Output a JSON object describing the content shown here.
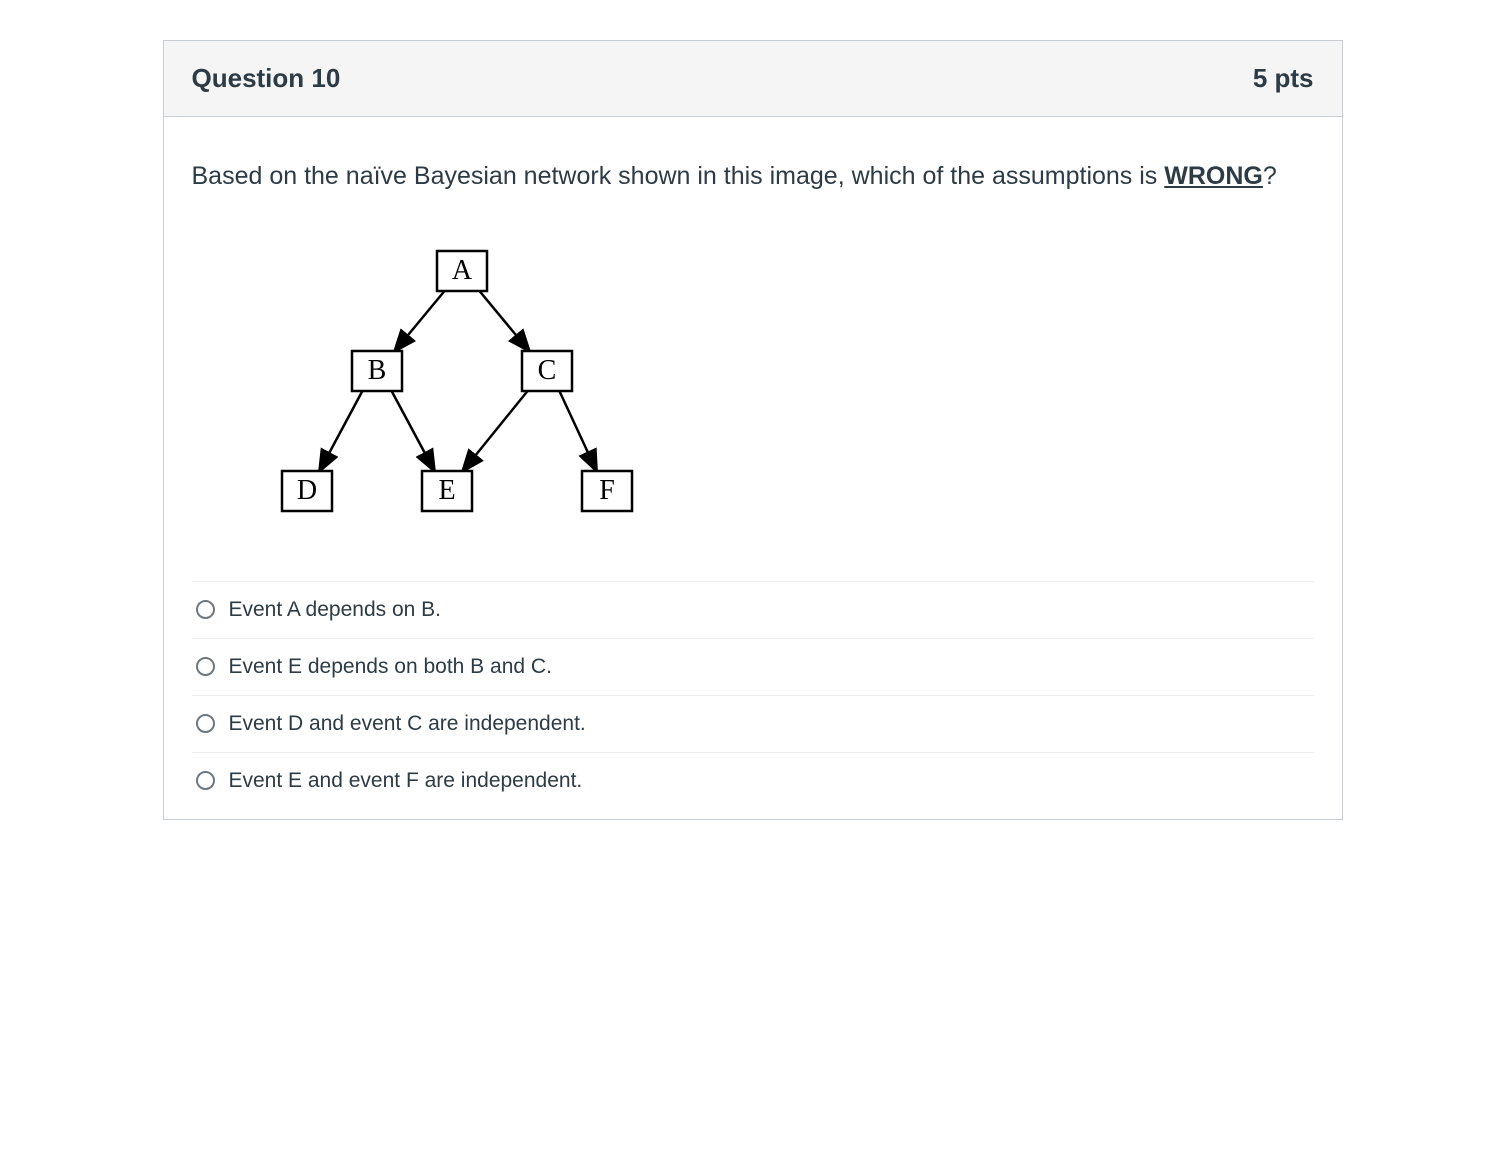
{
  "header": {
    "title": "Question 10",
    "points": "5 pts"
  },
  "prompt": {
    "pre": "Based on the naïve Bayesian network shown in this image, which of the assumptions is ",
    "emph": "WRONG",
    "post": "?"
  },
  "diagram": {
    "nodes": [
      "A",
      "B",
      "C",
      "D",
      "E",
      "F"
    ],
    "edges": [
      [
        "A",
        "B"
      ],
      [
        "A",
        "C"
      ],
      [
        "B",
        "D"
      ],
      [
        "B",
        "E"
      ],
      [
        "C",
        "E"
      ],
      [
        "C",
        "F"
      ]
    ]
  },
  "answers": [
    {
      "label": "Event A depends on B."
    },
    {
      "label": "Event E depends on both B and C."
    },
    {
      "label": "Event D and event C are independent."
    },
    {
      "label": "Event E and event F are independent."
    }
  ]
}
